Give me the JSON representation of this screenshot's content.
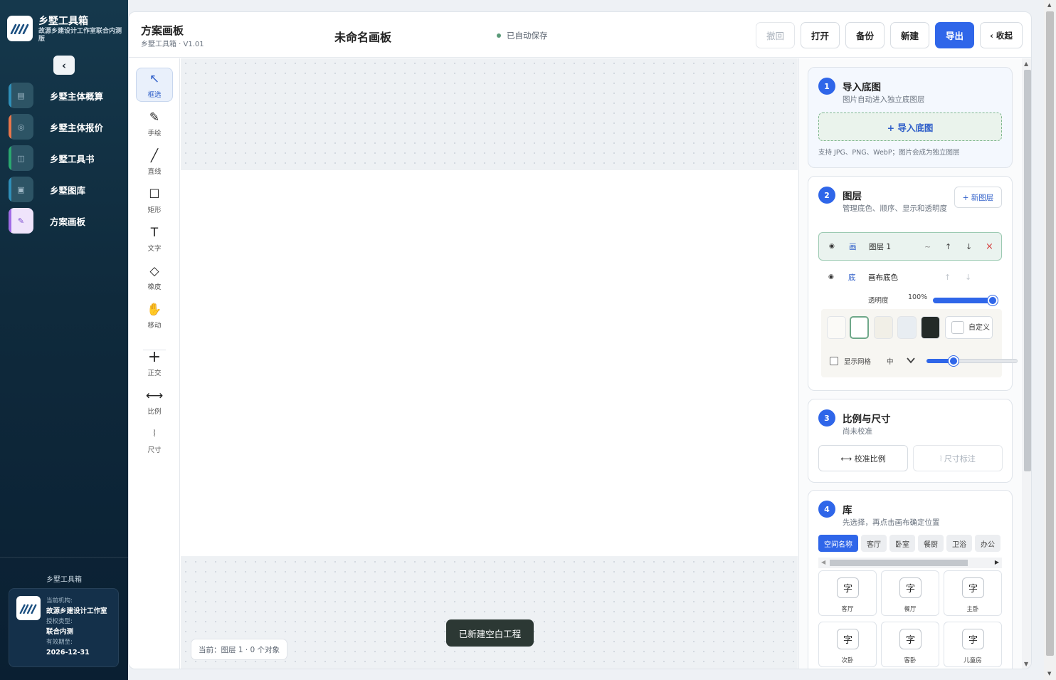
{
  "sidebar": {
    "brand_name": "乡墅工具箱",
    "brand_sub": "故源乡建设计工作室联合内测版",
    "collapse_icon": "‹",
    "items": [
      {
        "label": "乡墅主体概算",
        "icon": "calculator-icon"
      },
      {
        "label": "乡墅主体报价",
        "icon": "quote-icon"
      },
      {
        "label": "乡墅工具书",
        "icon": "book-icon"
      },
      {
        "label": "乡墅图库",
        "icon": "gallery-icon"
      },
      {
        "label": "方案画板",
        "icon": "pencil-icon"
      }
    ],
    "footer": {
      "title": "乡墅工具箱",
      "org_label": "当前机构:",
      "org_value": "故源乡建设计工作室",
      "license_label": "授权类型:",
      "license_value": "联合内测",
      "expire_label": "有效期至:",
      "expire_value": "2026-12-31"
    }
  },
  "header": {
    "app_title": "方案画板",
    "app_version": "乡墅工具箱 · V1.01",
    "doc_name": "未命名画板",
    "save_status": "已自动保存",
    "buttons": {
      "undo": "撤回",
      "open": "打开",
      "backup": "备份",
      "new": "新建",
      "export": "导出",
      "collapse": "‹ 收起"
    }
  },
  "tools": [
    {
      "label": "框选",
      "icon": "select-arrow-icon",
      "glyph": "↖"
    },
    {
      "label": "手绘",
      "icon": "pen-icon",
      "glyph": "✎"
    },
    {
      "label": "直线",
      "icon": "line-icon",
      "glyph": "╱"
    },
    {
      "label": "矩形",
      "icon": "rect-icon",
      "glyph": "☐"
    },
    {
      "label": "文字",
      "icon": "text-icon",
      "glyph": "T"
    },
    {
      "label": "橡皮",
      "icon": "eraser-icon",
      "glyph": "◇"
    },
    {
      "label": "移动",
      "icon": "hand-icon",
      "glyph": "✋"
    },
    {
      "label": "正交",
      "icon": "ortho-icon",
      "glyph": "+"
    },
    {
      "label": "比例",
      "icon": "scale-icon",
      "glyph": "⟷"
    },
    {
      "label": "尺寸",
      "icon": "dimension-icon",
      "glyph": "⦚"
    }
  ],
  "canvas": {
    "status": "当前：图层 1 · 0 个对象",
    "toast": "已新建空白工程"
  },
  "panel": {
    "import": {
      "num": "1",
      "title": "导入底图",
      "sub": "图片自动进入独立底图层",
      "button": "+ 导入底图",
      "note": "支持 JPG、PNG、WebP；图片会成为独立图层"
    },
    "layers": {
      "num": "2",
      "title": "图层",
      "sub": "管理底色、顺序、显示和透明度",
      "new_button": "+ 新图层",
      "rows": [
        {
          "radio": "◉",
          "type": "画",
          "name": "图层 1",
          "actions": [
            "~",
            "↑",
            "↓",
            "×"
          ]
        },
        {
          "radio": "◉",
          "type": "底",
          "name": "画布底色",
          "actions": [
            "↑",
            "↓"
          ]
        }
      ],
      "opacity_label": "透明度",
      "opacity_value": "100%",
      "opacity": 1.0,
      "swatches": [
        "#fbfaf7",
        "#ffffff",
        "#f1efe7",
        "#e8edf2",
        "#232a28"
      ],
      "custom_label": "自定义",
      "grid_label": "显示网格",
      "grid_size": "中",
      "grid_level": 0.3
    },
    "scale": {
      "num": "3",
      "title": "比例与尺寸",
      "sub": "尚未校准",
      "calibrate": "⟷  校准比例",
      "dimension": "⦚  尺寸标注"
    },
    "library": {
      "num": "4",
      "title": "库",
      "sub": "先选择，再点击画布确定位置",
      "tabs": [
        "空间名称",
        "客厅",
        "卧室",
        "餐厨",
        "卫浴",
        "办公"
      ],
      "glyph": "字",
      "items": [
        "客厅",
        "餐厅",
        "主卧",
        "次卧",
        "客卧",
        "儿童房"
      ]
    }
  }
}
